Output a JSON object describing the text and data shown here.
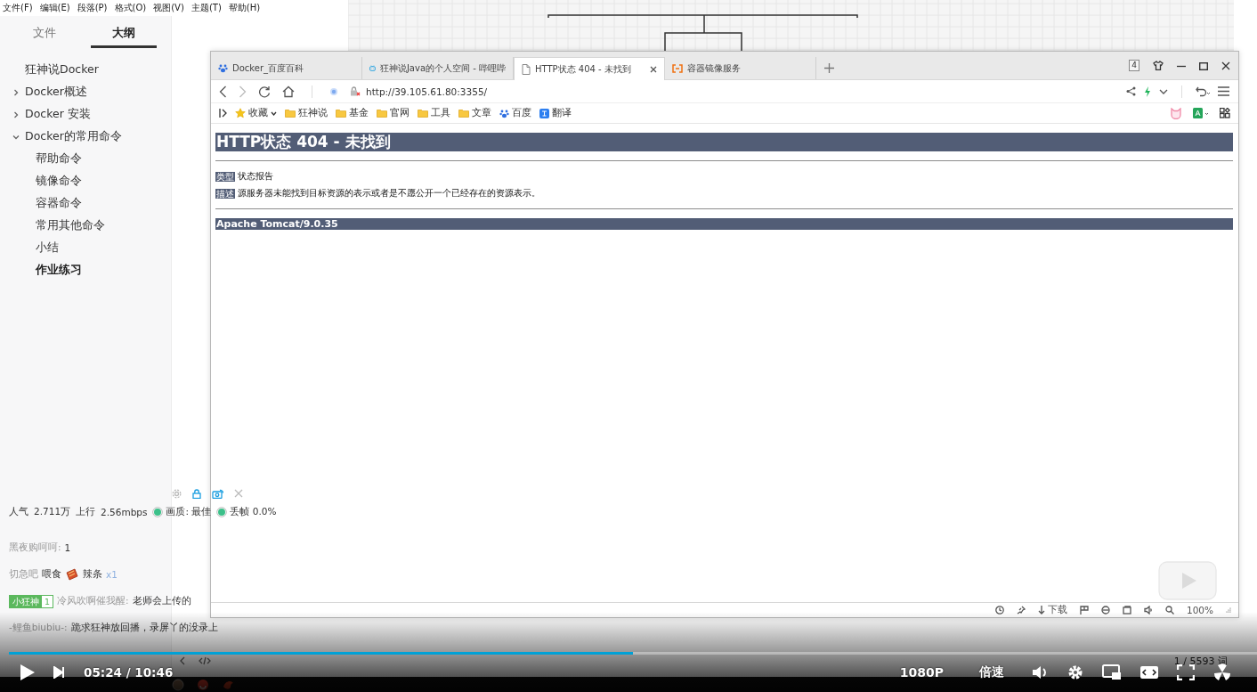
{
  "menu": [
    "文件(F)",
    "编辑(E)",
    "段落(P)",
    "格式(O)",
    "视图(V)",
    "主题(T)",
    "帮助(H)"
  ],
  "sidebar": {
    "tabs": [
      {
        "label": "文件",
        "selected": false
      },
      {
        "label": "大纲",
        "selected": true
      }
    ],
    "outline": [
      {
        "label": "狂神说Docker",
        "kind": "leaf",
        "selected": false
      },
      {
        "label": "Docker概述",
        "kind": "branch",
        "expanded": false,
        "selected": false
      },
      {
        "label": "Docker 安装",
        "kind": "branch",
        "expanded": false,
        "selected": false
      },
      {
        "label": "Docker的常用命令",
        "kind": "branch",
        "expanded": true,
        "selected": false,
        "children": [
          {
            "label": "帮助命令",
            "selected": false
          },
          {
            "label": "镜像命令",
            "selected": false
          },
          {
            "label": "容器命令",
            "selected": false
          },
          {
            "label": "常用其他命令",
            "selected": false
          },
          {
            "label": "小结",
            "selected": false
          },
          {
            "label": "作业练习",
            "selected": true
          }
        ]
      }
    ]
  },
  "editor": {
    "word_count": "1 / 5593 词"
  },
  "browser": {
    "tabs": [
      {
        "title": "Docker_百度百科",
        "kind": "paw",
        "selected": false
      },
      {
        "title": "狂神说Java的个人空间 - 哔哩哔",
        "kind": "tv",
        "selected": false
      },
      {
        "title": "HTTP状态 404 - 未找到",
        "kind": "page",
        "selected": true
      },
      {
        "title": "容器镜像服务",
        "kind": "cloud",
        "selected": false
      }
    ],
    "tab_count": "4",
    "url": "http://39.105.61.80:3355/",
    "bookmarks": [
      {
        "label": "收藏",
        "kind": "star"
      },
      {
        "label": "狂神说",
        "kind": "folder"
      },
      {
        "label": "基金",
        "kind": "folder"
      },
      {
        "label": "官网",
        "kind": "folder"
      },
      {
        "label": "工具",
        "kind": "folder"
      },
      {
        "label": "文章",
        "kind": "folder"
      },
      {
        "label": "百度",
        "kind": "paw"
      },
      {
        "label": "翻译",
        "kind": "translate"
      }
    ],
    "page": {
      "title": "HTTP状态 404 - 未找到",
      "fields": [
        {
          "label": "类型",
          "value": "状态报告"
        },
        {
          "label": "描述",
          "value": "源服务器未能找到目标资源的表示或者是不愿公开一个已经存在的资源表示。"
        }
      ],
      "footer": "Apache Tomcat/9.0.35"
    },
    "status_bar": {
      "download": "下载",
      "zoom": "100%"
    }
  },
  "stream": {
    "stats": [
      {
        "label": "人气",
        "value": "2.711万"
      },
      {
        "label": "上行",
        "value": "2.56mbps"
      }
    ],
    "indicators": [
      "画质: 最佳",
      "丢帧 0.0%"
    ],
    "chat": [
      {
        "kind": "text",
        "user": "黑夜购呵呵:",
        "text": "1"
      },
      {
        "kind": "gift",
        "user": "切急吧",
        "action": "喂食",
        "gift": "辣条",
        "count": "x1"
      },
      {
        "kind": "text",
        "badge": "小狂神",
        "badge_level": "1",
        "user": "冷风吹啊催我醒:",
        "text": "老师会上传的"
      },
      {
        "kind": "text",
        "user": "-鲤鱼biubiu-:",
        "text": "跪求狂神放回播，录屏丫的没录上"
      }
    ]
  },
  "player": {
    "level": 0.5,
    "time": "05:24 / 10:46",
    "quality": "1080P",
    "speed": "倍速"
  }
}
